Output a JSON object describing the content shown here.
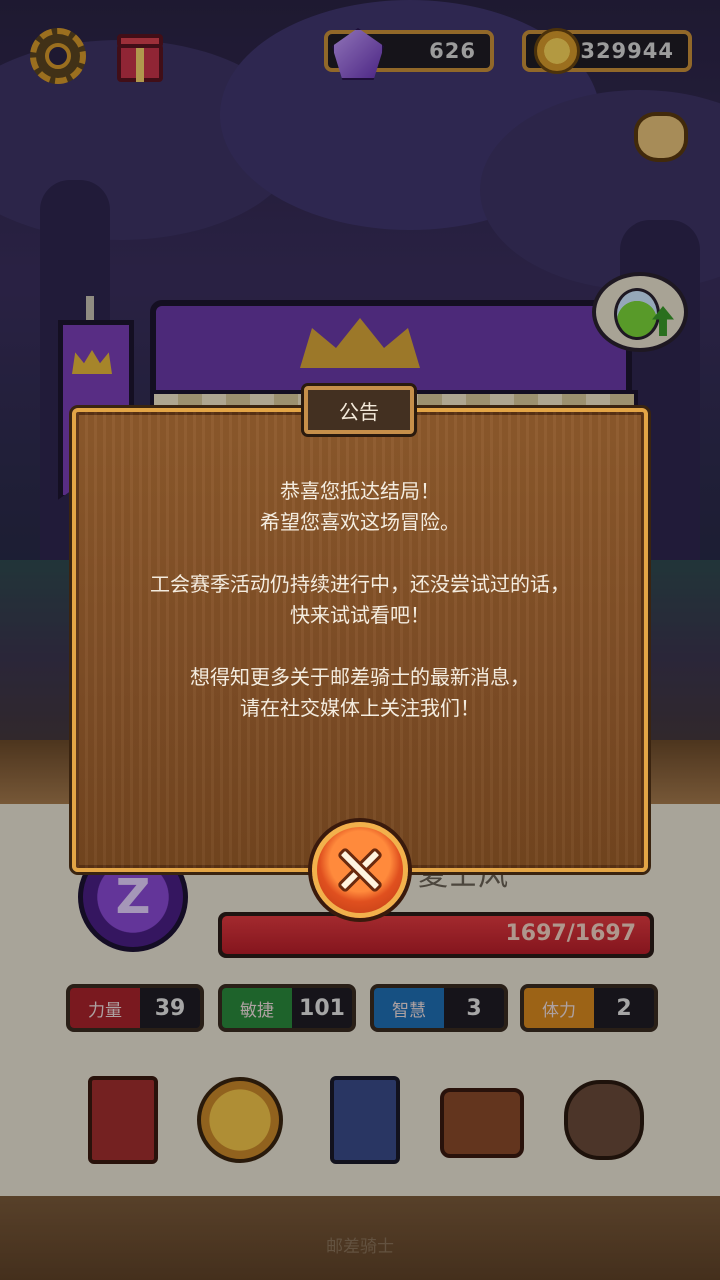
{
  "hud": {
    "gems": "626",
    "gold": "329944",
    "settings_icon": "gear-icon",
    "gift_icon": "gift-box-icon",
    "gem_icon": "purple-gem-icon",
    "coin_icon": "gold-coin-icon"
  },
  "modal": {
    "title": "公告",
    "lines": [
      "恭喜您抵达结局！",
      "希望您喜欢这场冒险。",
      "工会赛季活动仍持续进行中，还没尝试过的话，",
      "快来试试看吧！",
      "想得知更多关于邮差骑士的最新消息，",
      "请在社交媒体上关注我们！"
    ],
    "close_icon": "close-x-icon"
  },
  "hero": {
    "name_partial": "夏士风",
    "avatar_glyph": "Z",
    "hp": {
      "text": "1697/1697",
      "current": 1697,
      "max": 1697
    }
  },
  "stats": [
    {
      "label": "力量",
      "value": "39",
      "color": "#a9232c"
    },
    {
      "label": "敏捷",
      "value": "101",
      "color": "#2a8a3c"
    },
    {
      "label": "智慧",
      "value": "3",
      "color": "#1f6fb5"
    },
    {
      "label": "体力",
      "value": "2",
      "color": "#d98a1f"
    }
  ],
  "menu_icons": [
    "red-book-icon",
    "star-medal-icon",
    "sword-cards-icon",
    "backpack-icon",
    "loot-bag-icon"
  ],
  "footer": {
    "title": "邮差骑士"
  }
}
